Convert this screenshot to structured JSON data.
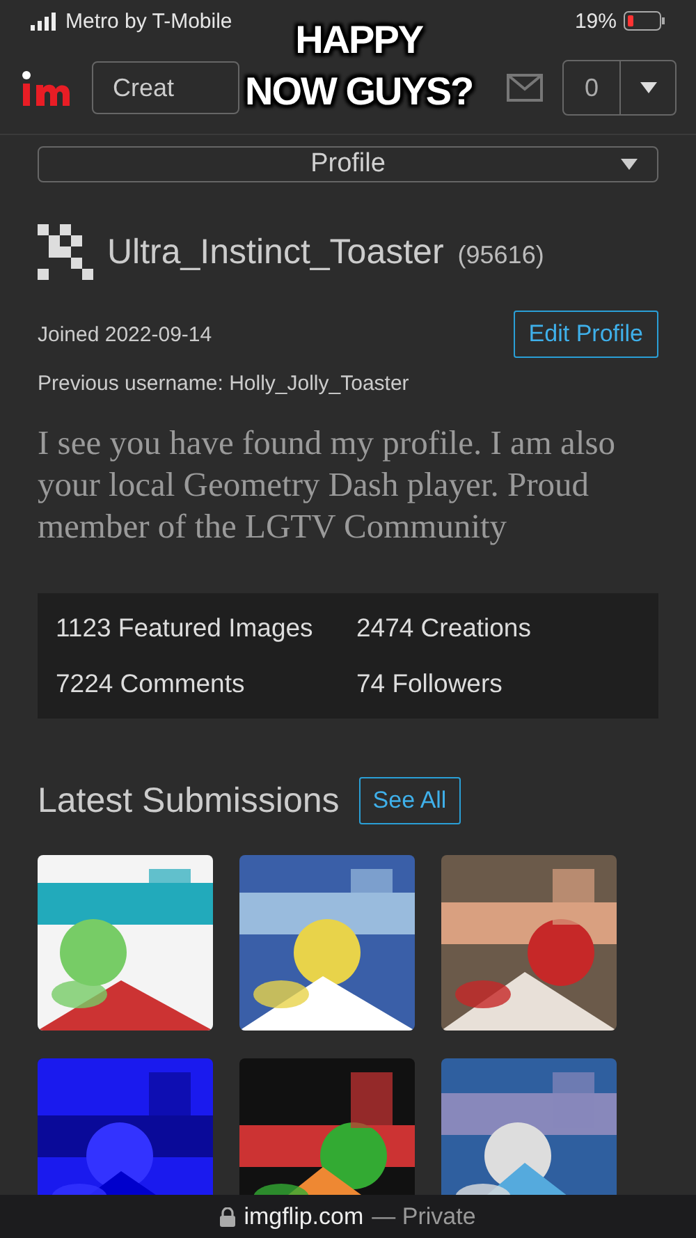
{
  "status_bar": {
    "carrier": "Metro by T-Mobile",
    "battery": "19%"
  },
  "caption": {
    "lines": [
      "HAPPY",
      "NOW GUYS?"
    ]
  },
  "nav": {
    "create": "Creat",
    "points": "0"
  },
  "profile_menu": {
    "label": "Profile"
  },
  "user": {
    "name": "Ultra_Instinct_Toaster",
    "points": "(95616)",
    "joined": "Joined 2022-09-14",
    "previous": "Previous username: Holly_Jolly_Toaster",
    "edit": "Edit Profile",
    "bio": "I see you have found my profile. I am also your local Geometry Dash player. Proud member of the LGTV Community"
  },
  "stats": [
    {
      "label": "1123 Featured Images"
    },
    {
      "label": "2474 Creations"
    },
    {
      "label": "7224 Comments"
    },
    {
      "label": "74 Followers"
    }
  ],
  "latest": {
    "title": "Latest Submissions",
    "see_all": "See All"
  },
  "browser_bar": {
    "domain": "imgflip.com",
    "mode": "— Private"
  }
}
